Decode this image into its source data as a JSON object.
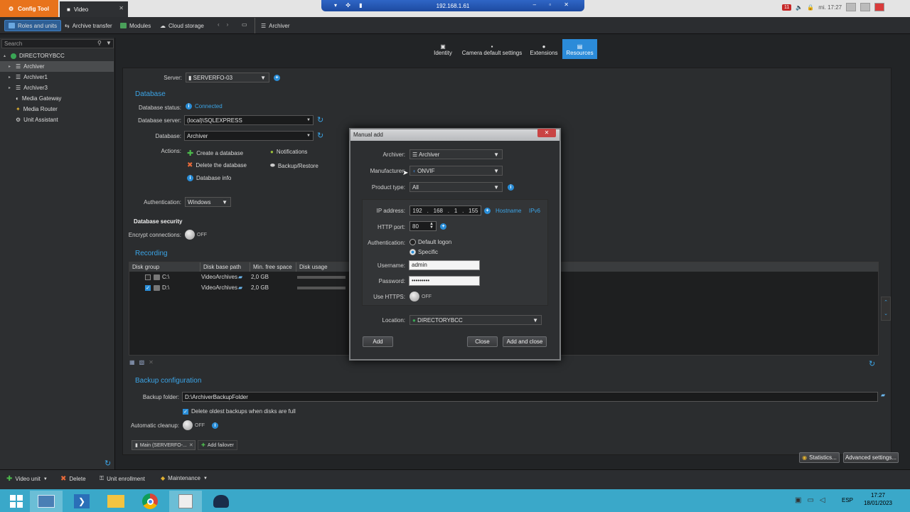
{
  "topbar": {
    "config_tab": "Config Tool",
    "video_tab": "Video",
    "remote_ip": "192.168.1.61",
    "tray_badge": "11",
    "tray_time": "mi. 17:27"
  },
  "toolbar": {
    "roles": "Roles and units",
    "archive_transfer": "Archive transfer",
    "modules": "Modules",
    "cloud_storage": "Cloud storage",
    "breadcrumb": "Archiver"
  },
  "search": {
    "placeholder": "Search"
  },
  "tree": {
    "root": "DIRECTORYBCC",
    "items": [
      "Archiver",
      "Archiver1",
      "Archiver3",
      "Media Gateway",
      "Media Router",
      "Unit Assistant"
    ]
  },
  "right_tabs": [
    "Identity",
    "Camera default settings",
    "Extensions",
    "Resources"
  ],
  "main": {
    "server_label": "Server:",
    "server_value": "SERVERFO-03",
    "database_section": "Database",
    "db_status_label": "Database status:",
    "db_status_value": "Connected",
    "db_server_label": "Database server:",
    "db_server_value": "(local)\\SQLEXPRESS",
    "database_label": "Database:",
    "database_value": "Archiver",
    "actions_label": "Actions:",
    "create_db": "Create a database",
    "delete_db": "Delete the database",
    "db_info": "Database info",
    "notifications": "Notifications",
    "backup_restore": "Backup/Restore",
    "auth_label": "Authentication:",
    "auth_value": "Windows",
    "db_security": "Database security",
    "encrypt_label": "Encrypt connections:",
    "toggle_off": "OFF",
    "recording_section": "Recording",
    "grid_headers": [
      "Disk group",
      "Disk base path",
      "Min. free space",
      "Disk usage"
    ],
    "grid_rows": [
      {
        "name": "C:\\",
        "path": "VideoArchives",
        "free": "2,0 GB"
      },
      {
        "name": "D:\\",
        "path": "VideoArchives",
        "free": "2,0 GB"
      }
    ],
    "backup_section": "Backup configuration",
    "backup_folder_label": "Backup folder:",
    "backup_folder_value": "D:\\ArchiverBackupFolder",
    "delete_oldest": "Delete oldest backups when disks are full",
    "auto_cleanup_label": "Automatic cleanup:",
    "main_tab": "Main (SERVERFO-...",
    "add_failover": "Add failover",
    "statistics": "Statistics...",
    "advanced": "Advanced settings..."
  },
  "dialog": {
    "title": "Manual add",
    "close_x": "✕",
    "archiver_label": "Archiver:",
    "archiver_value": "Archiver",
    "manufacturer_label": "Manufacturer:",
    "manufacturer_value": "ONVIF",
    "product_label": "Product type:",
    "product_value": "All",
    "ip_label": "IP address:",
    "ip": [
      "192",
      "168",
      "1",
      "155"
    ],
    "hostname": "Hostname",
    "ipv6": "IPv6",
    "http_label": "HTTP port:",
    "http_value": "80",
    "auth_label": "Authentication:",
    "auth_default": "Default logon",
    "auth_specific": "Specific",
    "username_label": "Username:",
    "username_value": "admin",
    "password_label": "Password:",
    "password_value": "•••••••••",
    "https_label": "Use HTTPS:",
    "https_value": "OFF",
    "location_label": "Location:",
    "location_value": "DIRECTORYBCC",
    "add_btn": "Add",
    "close_btn": "Close",
    "add_close_btn": "Add and close"
  },
  "bottom": {
    "video_unit": "Video unit",
    "delete": "Delete",
    "unit_enrollment": "Unit enrollment",
    "maintenance": "Maintenance"
  },
  "taskbar": {
    "lang": "ESP",
    "time": "17:27",
    "date": "18/01/2023"
  }
}
